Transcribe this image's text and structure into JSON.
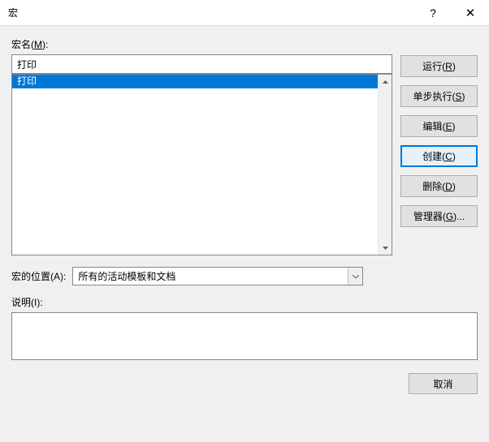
{
  "titlebar": {
    "title": "宏",
    "help": "?",
    "close": "✕"
  },
  "labels": {
    "macro_name": "宏名(",
    "macro_name_key": "M",
    "macro_name_end": "):",
    "location": "宏的位置(",
    "location_key": "A",
    "location_end": "):",
    "description": "说明(",
    "description_key": "I",
    "description_end": "):"
  },
  "macro_name_value": "打印",
  "macro_list": {
    "items": [
      "打印"
    ],
    "selected": 0
  },
  "location_value": "所有的活动模板和文档",
  "buttons": {
    "run": {
      "text": "运行(",
      "key": "R",
      "end": ")"
    },
    "step": {
      "text": "单步执行(",
      "key": "S",
      "end": ")"
    },
    "edit": {
      "text": "编辑(",
      "key": "E",
      "end": ")"
    },
    "create": {
      "text": "创建(",
      "key": "C",
      "end": ")"
    },
    "delete": {
      "text": "删除(",
      "key": "D",
      "end": ")"
    },
    "organizer": {
      "text": "管理器(",
      "key": "G",
      "end": ")..."
    },
    "cancel": "取消"
  }
}
